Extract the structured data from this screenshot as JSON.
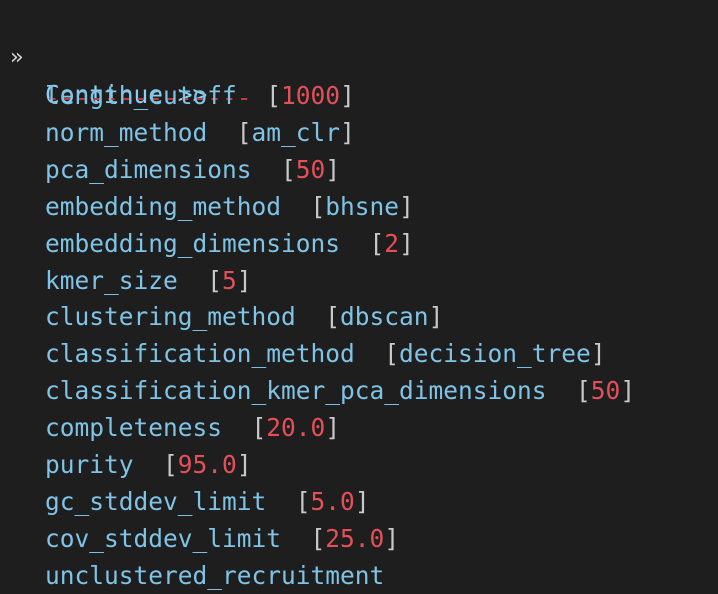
{
  "prompt": {
    "glyph": "»",
    "label": "Continue >>"
  },
  "separator": "--------------",
  "options": [
    {
      "name": "length_cutoff",
      "value": "1000",
      "value_type": "num"
    },
    {
      "name": "norm_method",
      "value": "am_clr",
      "value_type": "str"
    },
    {
      "name": "pca_dimensions",
      "value": "50",
      "value_type": "num"
    },
    {
      "name": "embedding_method",
      "value": "bhsne",
      "value_type": "str"
    },
    {
      "name": "embedding_dimensions",
      "value": "2",
      "value_type": "num"
    },
    {
      "name": "kmer_size",
      "value": "5",
      "value_type": "num"
    },
    {
      "name": "clustering_method",
      "value": "dbscan",
      "value_type": "str"
    },
    {
      "name": "classification_method",
      "value": "decision_tree",
      "value_type": "str"
    },
    {
      "name": "classification_kmer_pca_dimensions",
      "value": "50",
      "value_type": "num"
    },
    {
      "name": "completeness",
      "value": "20.0",
      "value_type": "num"
    },
    {
      "name": "purity",
      "value": "95.0",
      "value_type": "num"
    },
    {
      "name": "gc_stddev_limit",
      "value": "5.0",
      "value_type": "num"
    },
    {
      "name": "cov_stddev_limit",
      "value": "25.0",
      "value_type": "num"
    },
    {
      "name": "unclustered_recruitment",
      "value": null,
      "value_type": "none"
    }
  ],
  "colors": {
    "background": "#1e1e1e",
    "option_name": "#7fc3e6",
    "numeric_value": "#e4505a",
    "bracket": "#c9c9c9",
    "separator": "#b83c42"
  }
}
